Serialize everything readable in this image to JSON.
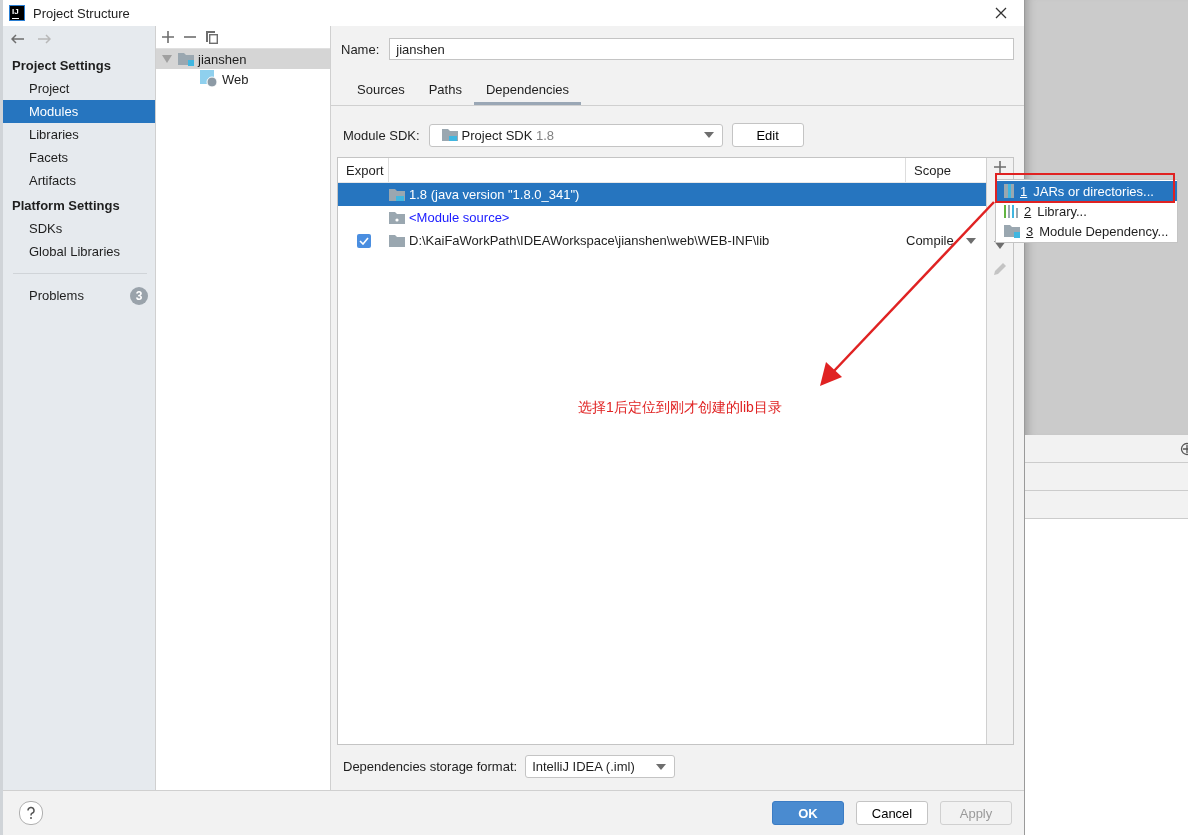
{
  "window": {
    "title": "Project Structure",
    "app_icon": "IJ"
  },
  "sidebar": {
    "sections": [
      {
        "heading": "Project Settings",
        "items": [
          {
            "label": "Project",
            "selected": false
          },
          {
            "label": "Modules",
            "selected": true
          },
          {
            "label": "Libraries",
            "selected": false
          },
          {
            "label": "Facets",
            "selected": false
          },
          {
            "label": "Artifacts",
            "selected": false
          }
        ]
      },
      {
        "heading": "Platform Settings",
        "items": [
          {
            "label": "SDKs",
            "selected": false
          },
          {
            "label": "Global Libraries",
            "selected": false
          }
        ]
      }
    ],
    "problems": {
      "label": "Problems",
      "count": "3"
    }
  },
  "modules_tree": {
    "items": [
      {
        "label": "jianshen",
        "kind": "module",
        "selected": true,
        "expanded": true,
        "children": [
          {
            "label": "Web",
            "kind": "web",
            "selected": false
          }
        ]
      }
    ]
  },
  "name_field": {
    "label": "Name:",
    "value": "jianshen"
  },
  "tabs": [
    {
      "label": "Sources",
      "selected": false
    },
    {
      "label": "Paths",
      "selected": false
    },
    {
      "label": "Dependencies",
      "selected": true
    }
  ],
  "module_sdk": {
    "label": "Module SDK:",
    "value": "Project SDK",
    "version": "1.8",
    "edit_button": "Edit"
  },
  "dependencies_table": {
    "columns": [
      "Export",
      "Scope"
    ],
    "rows": [
      {
        "kind": "sdk",
        "name": "1.8 (java version \"1.8.0_341\")",
        "selected": true
      },
      {
        "kind": "source",
        "name": "<Module source>",
        "selected": false
      },
      {
        "kind": "folder",
        "name": "D:\\KaiFaWorkPath\\IDEAWorkspace\\jianshen\\web\\WEB-INF\\lib",
        "export": true,
        "scope": "Compile",
        "selected": false
      }
    ]
  },
  "add_menu": {
    "items": [
      {
        "kind": "jar",
        "mnemonic": "1",
        "label": "JARs or directories...",
        "selected": true
      },
      {
        "kind": "library",
        "mnemonic": "2",
        "label": "Library...",
        "selected": false
      },
      {
        "kind": "module",
        "mnemonic": "3",
        "label": "Module Dependency...",
        "selected": false
      }
    ]
  },
  "storage_format": {
    "label": "Dependencies storage format:",
    "value": "IntelliJ IDEA (.iml)"
  },
  "annotation": {
    "text": "选择1后定位到刚才创建的lib目录"
  },
  "buttons": [
    {
      "label": "OK",
      "kind": "primary",
      "disabled": false
    },
    {
      "label": "Cancel",
      "kind": "normal",
      "disabled": false
    },
    {
      "label": "Apply",
      "kind": "normal",
      "disabled": true
    }
  ]
}
